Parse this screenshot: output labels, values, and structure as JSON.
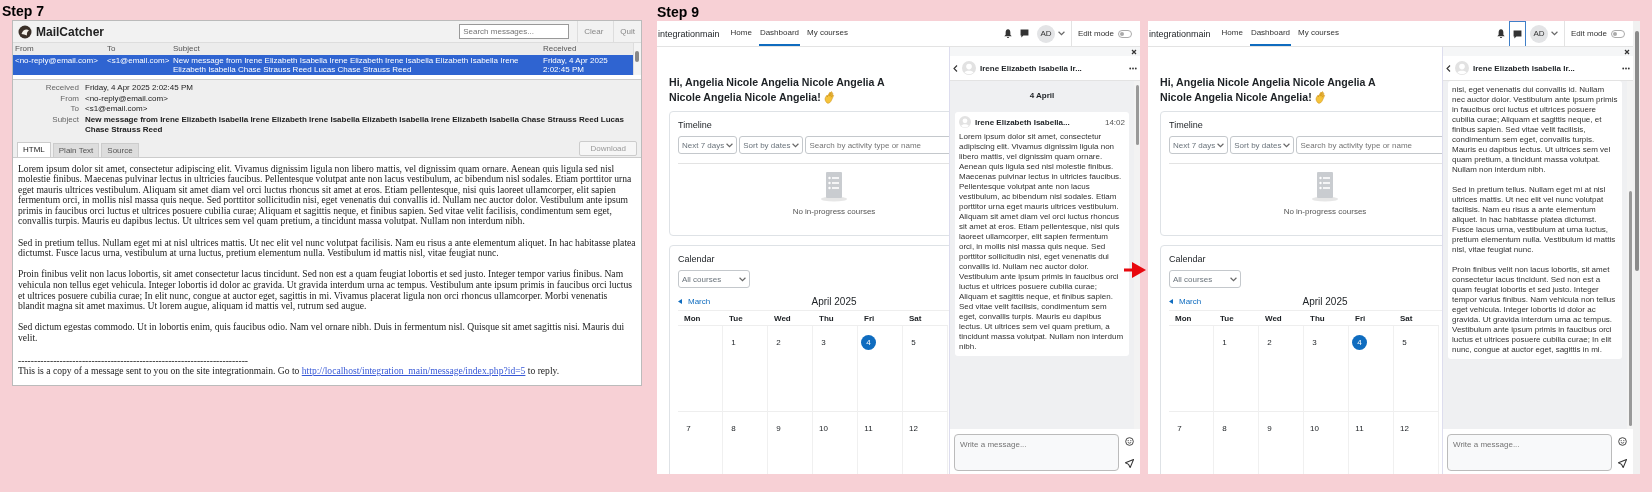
{
  "steps": [
    {
      "label": "Step 7",
      "mailcatcher": {
        "title": "MailCatcher",
        "search": {
          "placeholder": "Search messages..."
        },
        "buttons": [
          "Clear",
          "Quit"
        ],
        "columns": [
          "From",
          "To",
          "Subject",
          "Received"
        ],
        "rows": [
          {
            "from": "<no-reply@email.com>",
            "to": "<s1@email.com>",
            "subject": "New message from Irene Elizabeth Isabella Irene Elizabeth Irene Isabella Elizabeth Isabella Irene Elizabeth Isabella Chase Strauss Reed Lucas Chase Strauss Reed",
            "received": "Friday, 4 Apr 2025 2:02:45 PM",
            "selected": true
          }
        ],
        "details": [
          {
            "label": "Received",
            "value": "Friday, 4 Apr 2025 2:02:45 PM"
          },
          {
            "label": "From",
            "value": "<no-reply@email.com>"
          },
          {
            "label": "To",
            "value": "<s1@email.com>"
          },
          {
            "label": "Subject",
            "value": "New message from Irene Elizabeth Isabella Irene Elizabeth Irene Isabella Elizabeth Isabella Irene Elizabeth Isabella Chase Strauss Reed Lucas Chase Strauss Reed"
          }
        ],
        "tabs": [
          {
            "label": "HTML",
            "selected": true
          },
          {
            "label": "Plain Text",
            "selected": false
          },
          {
            "label": "Source",
            "selected": false
          }
        ],
        "download": "Download",
        "body": {
          "paragraphs": [
            "Lorem ipsum dolor sit amet, consectetur adipiscing elit. Vivamus dignissim ligula non libero mattis, vel dignissim quam ornare. Aenean quis ligula sed nisl molestie finibus. Maecenas pulvinar lectus in ultricies faucibus. Pellentesque volutpat ante non lacus vestibulum, ac bibendum nisl sodales. Etiam porttitor urna eget mauris ultrices vestibulum. Aliquam sit amet diam vel orci luctus rhoncus sit amet at eros. Etiam pellentesque, nisi quis laoreet ullamcorper, elit sapien fermentum orci, in mollis nisl massa quis neque. Sed porttitor sollicitudin nisi, eget venenatis dui convallis id. Nullam nec auctor dolor. Vestibulum ante ipsum primis in faucibus orci luctus et ultrices posuere cubilia curae; Aliquam et sagittis neque, et finibus sapien. Sed vitae velit facilisis, condimentum sem eget, convallis turpis. Mauris eu dapibus lectus. Ut ultrices sem vel quam pretium, a tincidunt massa volutpat. Nullam non interdum nibh.",
            "Sed in pretium tellus. Nullam eget mi at nisl ultrices mattis. Ut nec elit vel nunc volutpat facilisis. Nam eu risus a ante elementum aliquet. In hac habitasse platea dictumst. Fusce lacus urna, vestibulum at urna luctus, pretium elementum nulla. Vestibulum id mattis nisl, vitae feugiat nunc.",
            "Proin finibus velit non lacus lobortis, sit amet consectetur lacus tincidunt. Sed non est a quam feugiat lobortis et sed justo. Integer tempor varius finibus. Nam vehicula non tellus eget vehicula. Integer lobortis id dolor ac gravida. Ut gravida interdum urna ac tempus. Vestibulum ante ipsum primis in faucibus orci luctus et ultrices posuere cubilia curae; In elit nunc, congue at auctor eget, sagittis in mi. Vivamus placerat ligula non orci rhoncus ullamcorper. Morbi venenatis blandit magna sit amet maximus. Ut lorem augue, aliquam id mattis vel, rutrum sed augue.",
            "Sed dictum egestas commodo. Ut in lobortis enim, quis faucibus odio. Nam vel ornare nibh. Duis in fermentum nisl. Quisque sit amet sagittis nisi. Mauris dui velit."
          ],
          "rule": "------------------------------------------------------------------------",
          "footer": {
            "text": "This is a copy of a message sent to you on the site integrationmain. Go to",
            "link": "http://localhost/integration_main/message/index.php?id=5",
            "after": "to reply."
          }
        }
      }
    },
    {
      "label": "Step 9",
      "screens": [
        {
          "site_name": "integrationmain",
          "nav": [
            {
              "label": "Home",
              "selected": false
            },
            {
              "label": "Dashboard",
              "selected": true
            },
            {
              "label": "My courses",
              "selected": false
            }
          ],
          "messages_focused": false,
          "avatar_initials": "AD",
          "edit_mode": {
            "label": "Edit mode",
            "on": false
          },
          "page_scrollbar": false,
          "greeting": [
            "Hi, Angelia Nicole Angelia Nicole Angelia A",
            "Nicole Angelia Nicole Angelia!"
          ],
          "timeline": {
            "title": "Timeline",
            "filters": [
              "Next 7 days",
              "Sort by dates"
            ],
            "search": {
              "placeholder": "Search by activity type or name"
            },
            "empty_text": "No in-progress courses"
          },
          "calendar": {
            "title": "Calendar",
            "course_filter": "All courses",
            "prev_link": "March",
            "month": "April 2025",
            "weekdays": [
              "Mon",
              "Tue",
              "Wed",
              "Thu",
              "Fri",
              "Sat"
            ],
            "weeks": [
              [
                {
                  "kind": "empty"
                },
                {
                  "kind": "day",
                  "day": "1",
                  "today": false
                },
                {
                  "kind": "day",
                  "day": "2",
                  "today": false
                },
                {
                  "kind": "day",
                  "day": "3",
                  "today": false
                },
                {
                  "kind": "day",
                  "day": "4",
                  "today": true
                },
                {
                  "kind": "day",
                  "day": "5",
                  "today": false
                }
              ],
              [
                {
                  "kind": "day",
                  "day": "7",
                  "today": false
                },
                {
                  "kind": "day",
                  "day": "8",
                  "today": false
                },
                {
                  "kind": "day",
                  "day": "9",
                  "today": false
                },
                {
                  "kind": "day",
                  "day": "10",
                  "today": false
                },
                {
                  "kind": "day",
                  "day": "11",
                  "today": false
                },
                {
                  "kind": "day",
                  "day": "12",
                  "today": false
                }
              ]
            ]
          },
          "chat": {
            "contact": "Irene Elizabeth Isabella Ir...",
            "date": "4 April",
            "message": {
              "sender": "Irene Elizabeth Isabella...",
              "time": "14:02",
              "paragraphs": [
                "Lorem ipsum dolor sit amet, consectetur adipiscing elit. Vivamus dignissim ligula non libero mattis, vel dignissim quam ornare. Aenean quis ligula sed nisl molestie finibus. Maecenas pulvinar lectus in ultricies faucibus. Pellentesque volutpat ante non lacus vestibulum, ac bibendum nisl sodales. Etiam porttitor urna eget mauris ultrices vestibulum. Aliquam sit amet diam vel orci luctus rhoncus sit amet at eros. Etiam pellentesque, nisi quis laoreet ullamcorper, elit sapien fermentum orci, in mollis nisl massa quis neque. Sed porttitor sollicitudin nisi, eget venenatis dui convallis id. Nullam nec auctor dolor. Vestibulum ante ipsum primis in faucibus orci luctus et ultrices posuere cubilia curae; Aliquam et sagittis neque, et finibus sapien. Sed vitae velit facilisis, condimentum sem eget, convallis turpis. Mauris eu dapibus lectus. Ut ultrices sem vel quam pretium, a tincidunt massa volutpat. Nullam non interdum nibh."
              ]
            },
            "composer": {
              "placeholder": "Write a message..."
            }
          }
        },
        {
          "site_name": "integrationmain",
          "nav": [
            {
              "label": "Home",
              "selected": false
            },
            {
              "label": "Dashboard",
              "selected": true
            },
            {
              "label": "My courses",
              "selected": false
            }
          ],
          "messages_focused": true,
          "avatar_initials": "AD",
          "edit_mode": {
            "label": "Edit mode",
            "on": false
          },
          "page_scrollbar": true,
          "greeting": [
            "Hi, Angelia Nicole Angelia Nicole Angelia A",
            "Nicole Angelia Nicole Angelia!"
          ],
          "timeline": {
            "title": "Timeline",
            "filters": [
              "Next 7 days",
              "Sort by dates"
            ],
            "search": {
              "placeholder": "Search by activity type or name"
            },
            "empty_text": "No in-progress courses"
          },
          "calendar": {
            "title": "Calendar",
            "course_filter": "All courses",
            "prev_link": "March",
            "month": "April 2025",
            "weekdays": [
              "Mon",
              "Tue",
              "Wed",
              "Thu",
              "Fri",
              "Sat"
            ],
            "weeks": [
              [
                {
                  "kind": "empty"
                },
                {
                  "kind": "day",
                  "day": "1",
                  "today": false
                },
                {
                  "kind": "day",
                  "day": "2",
                  "today": false
                },
                {
                  "kind": "day",
                  "day": "3",
                  "today": false
                },
                {
                  "kind": "day",
                  "day": "4",
                  "today": true
                },
                {
                  "kind": "day",
                  "day": "5",
                  "today": false
                }
              ],
              [
                {
                  "kind": "day",
                  "day": "7",
                  "today": false
                },
                {
                  "kind": "day",
                  "day": "8",
                  "today": false
                },
                {
                  "kind": "day",
                  "day": "9",
                  "today": false
                },
                {
                  "kind": "day",
                  "day": "10",
                  "today": false
                },
                {
                  "kind": "day",
                  "day": "11",
                  "today": false
                },
                {
                  "kind": "day",
                  "day": "12",
                  "today": false
                }
              ]
            ]
          },
          "chat": {
            "contact": "Irene Elizabeth Isabella Ir...",
            "message": {
              "paragraphs": [
                "nisi, eget venenatis dui convallis id. Nullam nec auctor dolor. Vestibulum ante ipsum primis in faucibus orci luctus et ultrices posuere cubilia curae; Aliquam et sagittis neque, et finibus sapien. Sed vitae velit facilisis, condimentum sem eget, convallis turpis. Mauris eu dapibus lectus. Ut ultrices sem vel quam pretium, a tincidunt massa volutpat. Nullam non interdum nibh.",
                "Sed in pretium tellus. Nullam eget mi at nisl ultrices mattis. Ut nec elit vel nunc volutpat facilisis. Nam eu risus a ante elementum aliquet. In hac habitasse platea dictumst. Fusce lacus urna, vestibulum at urna luctus, pretium elementum nulla. Vestibulum id mattis nisl, vitae feugiat nunc.",
                "Proin finibus velit non lacus lobortis, sit amet consectetur lacus tincidunt. Sed non est a quam feugiat lobortis et sed justo. Integer tempor varius finibus. Nam vehicula non tellus eget vehicula. Integer lobortis id dolor ac gravida. Ut gravida interdum urna ac tempus. Vestibulum ante ipsum primis in faucibus orci luctus et ultrices posuere cubilia curae; In elit nunc, congue at auctor eget, sagittis in mi."
              ]
            },
            "composer": {
              "placeholder": "Write a message..."
            }
          }
        }
      ]
    }
  ]
}
